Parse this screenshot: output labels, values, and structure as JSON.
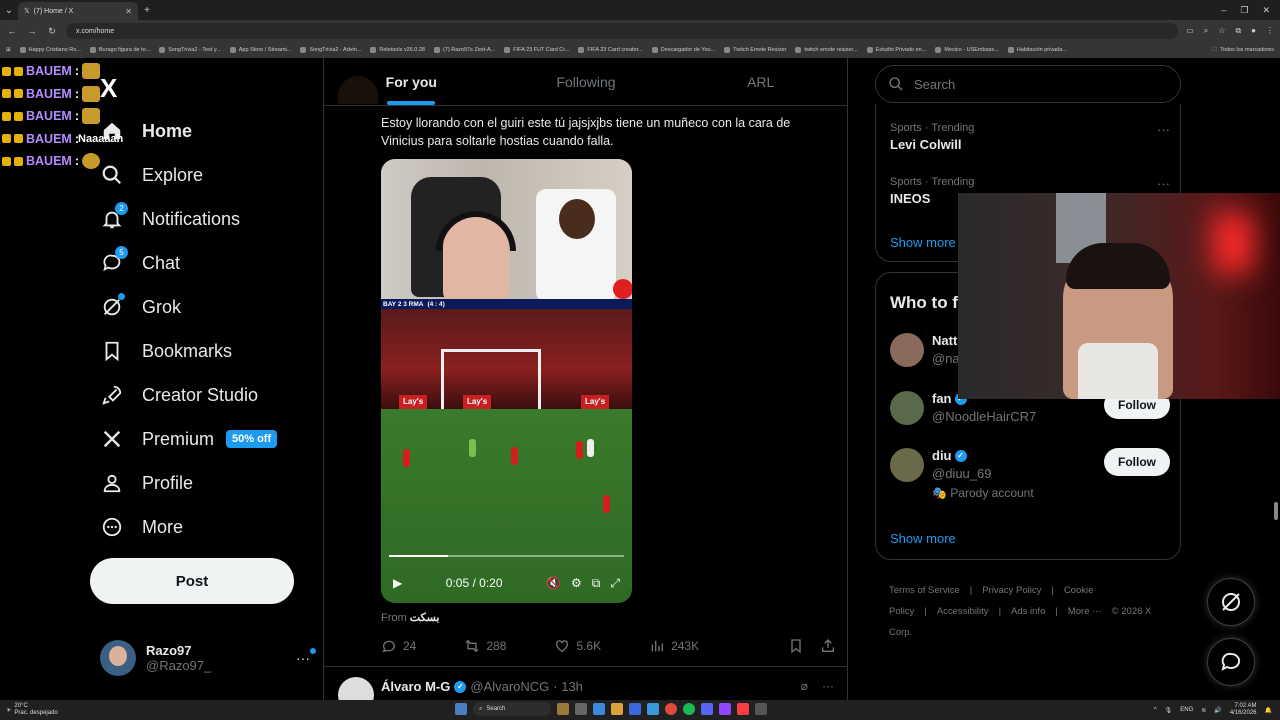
{
  "browser": {
    "tab_title": "(7) Home / X",
    "url": "x.com/home",
    "bookmarks": [
      "Happy Cristiano Ro...",
      "Burago figura de to...",
      "SongTrivia2 - Test y...",
      "App Store / Streami...",
      "SongTrivia2 - Advin...",
      "Reletools v26.0.28",
      "(7) Razo97s Zest-A...",
      "FIFA 23 FUT Card Cr...",
      "FIFA 23 Card creator...",
      "Descargador de You...",
      "Twitch Emote Resizer",
      "twitch emote resizer...",
      "Estudio Privado en...",
      "Mexico - USEmbass...",
      "Habitación privada..."
    ],
    "bookmarks_folder": "Todos los marcadores"
  },
  "chat": {
    "lines": [
      {
        "user": "BAUEM",
        "sep": ":"
      },
      {
        "user": "BAUEM",
        "sep": ":"
      },
      {
        "user": "BAUEM",
        "sep": ":"
      },
      {
        "user": "BAUEM",
        "sep": ":",
        "text": "Naaaaah"
      },
      {
        "user": "BAUEM",
        "sep": ":"
      }
    ]
  },
  "sidebar": {
    "logo": "X",
    "items": [
      {
        "label": "Home"
      },
      {
        "label": "Explore"
      },
      {
        "label": "Notifications",
        "badge": "2"
      },
      {
        "label": "Chat",
        "badge": "5"
      },
      {
        "label": "Grok"
      },
      {
        "label": "Bookmarks"
      },
      {
        "label": "Creator Studio"
      },
      {
        "label": "Premium",
        "promo": "50% off"
      },
      {
        "label": "Profile"
      },
      {
        "label": "More"
      }
    ],
    "post_label": "Post",
    "account": {
      "name": "Razo97",
      "handle": "@Razo97_"
    }
  },
  "feed": {
    "tabs": [
      "For you",
      "Following",
      "ARL"
    ],
    "post": {
      "text": "Estoy llorando con el guiri este tú jajsjxjbs tiene un muñeco con la cara de Vinicius para soltarle hostias cuando falla.",
      "video": {
        "score": "BAY  2  3  RMA",
        "agg": "(4 : 4)",
        "time": "0:05 / 0:20",
        "progress": 0.25
      },
      "from_label": "From",
      "from_name": "بسکت",
      "stats": {
        "replies": "24",
        "reposts": "288",
        "likes": "5.6K",
        "views": "243K"
      }
    },
    "next_post": {
      "name": "Álvaro M-G",
      "handle": "@AlvaroNCG",
      "time": "· 13h"
    }
  },
  "right": {
    "search_placeholder": "Search",
    "trends": [
      {
        "category": "Sports · Trending",
        "name": "Levi Colwill"
      },
      {
        "category": "Sports · Trending",
        "name": "INEOS"
      }
    ],
    "show_more": "Show more",
    "who_to_follow_title": "Who to f",
    "follow_suggestions": [
      {
        "name": "Natt",
        "handle": "@na"
      },
      {
        "name": "fan",
        "handle": "@NoodleHairCR7",
        "button": "Follow"
      },
      {
        "name": "diu",
        "handle": "@diuu_69",
        "extra": "Parody account",
        "button": "Follow"
      }
    ],
    "show_more_2": "Show more",
    "footer": [
      "Terms of Service",
      "|",
      "Privacy Policy",
      "|",
      "Cookie Policy",
      "|",
      "Accessibility",
      "|",
      "Ads info",
      "|",
      "More ···",
      "© 2026 X Corp."
    ]
  },
  "taskbar": {
    "temp": "20°C",
    "weather": "Prac. despejado",
    "search": "Search",
    "lang": "ENG",
    "time": "7:02 AM",
    "date": "4/16/2026"
  },
  "colors": {
    "accent": "#1d9bf0",
    "bg": "#000000",
    "text": "#e7e9ea",
    "muted": "#71767b",
    "chat_user": "#b48cff"
  }
}
